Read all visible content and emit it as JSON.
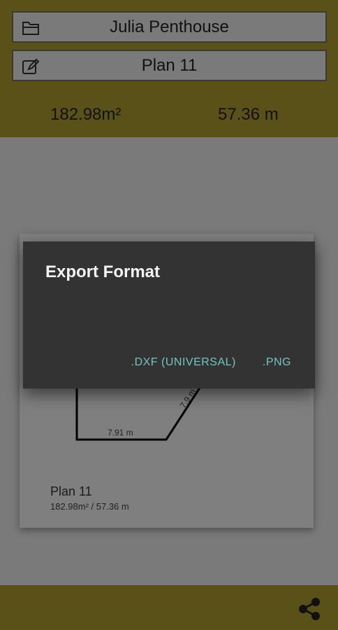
{
  "header": {
    "project_name": "Julia Penthouse",
    "plan_name": "Plan 11",
    "area": "182.98m²",
    "perimeter": "57.36 m"
  },
  "preview": {
    "edge_bottom": "7.91 m",
    "edge_diagonal": "7.9 m",
    "title": "Plan 11",
    "summary": "182.98m² / 57.36 m"
  },
  "dialog": {
    "title": "Export Format",
    "options": [
      ".DXF (UNIVERSAL)",
      ".PNG"
    ]
  },
  "colors": {
    "accent": "#5a5119",
    "dialog_bg": "#333333",
    "button_text": "#6fc7c0"
  },
  "icons": {
    "project": "folder-icon",
    "plan": "edit-icon",
    "share": "share-icon"
  }
}
